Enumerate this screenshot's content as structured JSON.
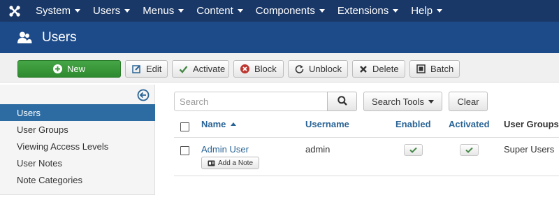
{
  "topnav": {
    "items": [
      {
        "label": "System",
        "icon": "caret-down"
      },
      {
        "label": "Users",
        "icon": "caret-down"
      },
      {
        "label": "Menus",
        "icon": "caret-down"
      },
      {
        "label": "Content",
        "icon": "caret-down"
      },
      {
        "label": "Components",
        "icon": "caret-down"
      },
      {
        "label": "Extensions",
        "icon": "caret-down"
      },
      {
        "label": "Help",
        "icon": "caret-down"
      }
    ]
  },
  "header": {
    "title": "Users",
    "icon": "users-icon"
  },
  "toolbar": {
    "new_label": "New",
    "edit_label": "Edit",
    "activate_label": "Activate",
    "block_label": "Block",
    "unblock_label": "Unblock",
    "delete_label": "Delete",
    "batch_label": "Batch"
  },
  "sidebar": {
    "items": [
      {
        "label": "Users",
        "active": true
      },
      {
        "label": "User Groups"
      },
      {
        "label": "Viewing Access Levels"
      },
      {
        "label": "User Notes"
      },
      {
        "label": "Note Categories"
      }
    ]
  },
  "filters": {
    "search_placeholder": "Search",
    "search_value": "",
    "search_tools_label": "Search Tools",
    "clear_label": "Clear"
  },
  "table": {
    "columns": {
      "name": "Name",
      "username": "Username",
      "enabled": "Enabled",
      "activated": "Activated",
      "user_groups": "User Groups"
    },
    "rows": [
      {
        "name": "Admin User",
        "note_label": "Add a Note",
        "username": "admin",
        "enabled": true,
        "activated": true,
        "groups": "Super Users"
      }
    ]
  },
  "colors": {
    "topnav_bg": "#1a3867",
    "titlebar_bg": "#1d4b89",
    "new_button": "#3c9a3c",
    "sidebar_active": "#2d6ca2",
    "link": "#2a6496",
    "check_green": "#468847"
  }
}
